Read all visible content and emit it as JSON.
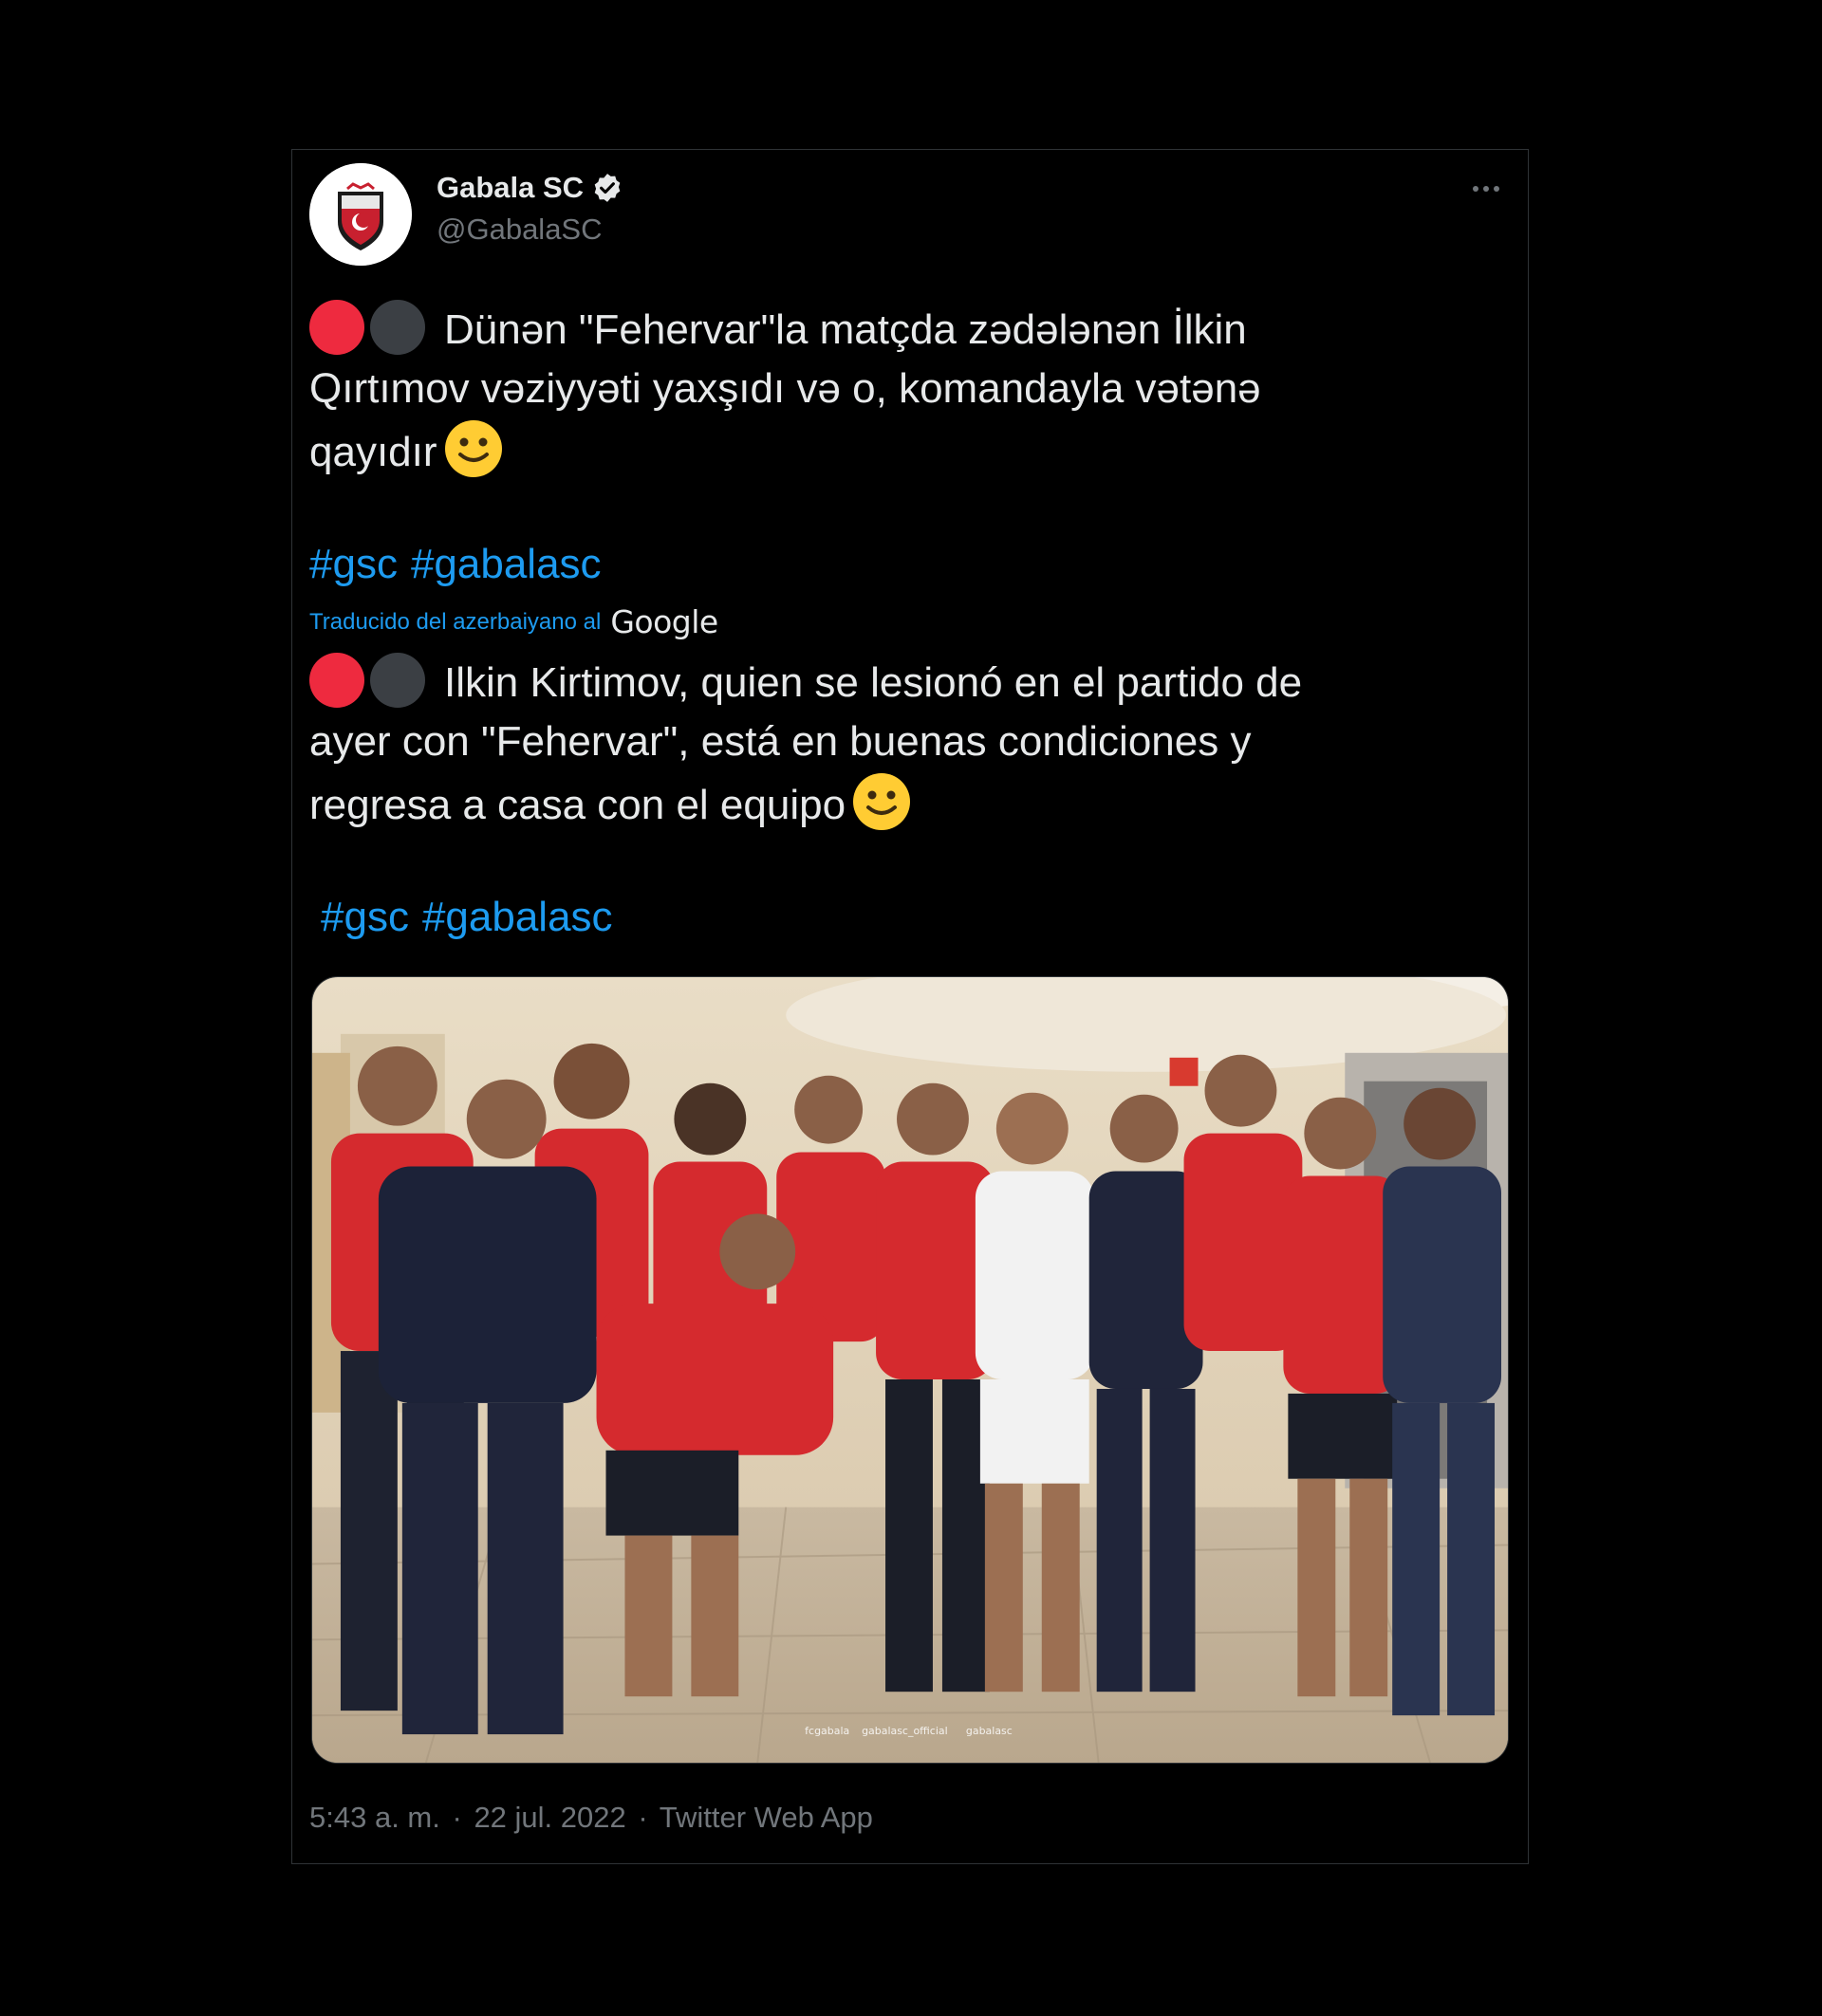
{
  "tweet": {
    "author": {
      "display_name": "Gabala SC",
      "handle": "@GabalaSC",
      "verified_icon": "verified-badge-icon",
      "avatar_icon": "gabala-sc-crest-logo"
    },
    "more_icon": "more-horizontal-icon",
    "original_text": {
      "line1": "Dünən \"Fehervar\"la matçda zədələnən İlkin",
      "line2": "Qırtımov vəziyyəti yaxşıdı və o, komandayla vətənə",
      "line3": "qayıdır"
    },
    "original_hashtags": [
      "#gsc",
      "#gabalasc"
    ],
    "translation_label": "Traducido del azerbaiyano al",
    "translation_provider": "Google",
    "translated_text": {
      "line1": "Ilkin Kirtimov, quien se lesionó en el partido de",
      "line2": "ayer con \"Fehervar\", está en buenas condiciones y",
      "line3": "regresa a casa con el equipo"
    },
    "translated_hashtags": [
      "#gsc",
      "#gabalasc"
    ],
    "emoji": [
      "red-circle",
      "black-circle",
      "slightly-smiling-face"
    ],
    "photo_watermark": {
      "fb": "fcgabala",
      "ig": "gabalasc_official",
      "tw": "gabalasc"
    },
    "timestamp": {
      "time": "5:43 a. m.",
      "sep1": "·",
      "date": "22 jul. 2022",
      "sep2": "·",
      "source": "Twitter Web App"
    }
  },
  "colors": {
    "background": "#000000",
    "text": "#e7e9ea",
    "secondary_text": "#71767b",
    "link": "#1d9bf0",
    "red_circle": "#ee2a3f",
    "black_circle": "#3b3f44",
    "border": "#2f3336"
  }
}
